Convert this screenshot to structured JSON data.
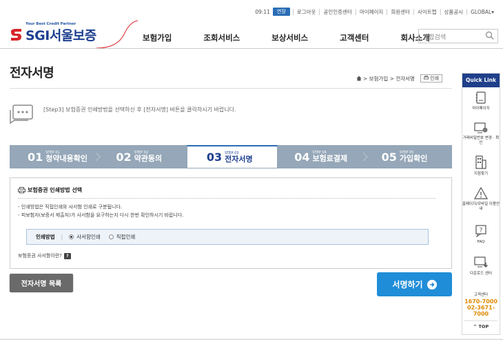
{
  "util": {
    "time": "09:11",
    "extend": "연장",
    "links": [
      "로그아웃",
      "공인인증센터",
      "마이페이지",
      "회원센터",
      "사이트맵",
      "상품공시",
      "GLOBAL▾"
    ]
  },
  "logo": {
    "tagline": "Your Best Credit Partner",
    "name_sgi": "SGI",
    "name_kr": "서울보증"
  },
  "gnb": [
    "보험가입",
    "조회서비스",
    "보상서비스",
    "고객센터",
    "회사소개"
  ],
  "search": {
    "placeholder": "통합검색"
  },
  "page": {
    "title": "전자서명",
    "breadcrumb": "> 보험가입 > 전자서명",
    "print": "인쇄"
  },
  "notice": "[Step3] 보험증권 인쇄방법을 선택하신 후 [전자서명] 버튼을 클릭하시기 바랍니다.",
  "steps": [
    {
      "num": "01",
      "step": "STEP 01",
      "name": "청약내용확인"
    },
    {
      "num": "02",
      "step": "STEP 02",
      "name": "약관동의"
    },
    {
      "num": "03",
      "step": "STEP 03",
      "name": "전자서명"
    },
    {
      "num": "04",
      "step": "STEP 04",
      "name": "보험료결제"
    },
    {
      "num": "05",
      "step": "STEP 05",
      "name": "가입확인"
    }
  ],
  "box": {
    "title": "보험증권 인쇄방법 선택",
    "bullets": [
      "- 인쇄방법은 직접인쇄와 사서함 인쇄로 구분됩니다.",
      "- 피보험자(보증서 제출처)가 사서함을 요구하는지 다시 한번 확인하시기 바랍니다."
    ],
    "method_label": "인쇄방법",
    "option_1": "사서함인쇄",
    "option_2": "직접인쇄",
    "selected": "사서함인쇄",
    "qa": "보험증권 사서함이란?",
    "qa_badge": "?"
  },
  "buttons": {
    "list": "전자서명 목록",
    "sign": "서명하기"
  },
  "quick": {
    "title": "Quick Link",
    "items": [
      "마이페이지",
      "거래비밀번호 변경 · 확인",
      "지점찾기",
      "홈페이지/모바일 이용안내",
      "FAQ",
      "다운로드 센터"
    ],
    "tel_label": "고객센터",
    "tel_1": "1670-7000",
    "tel_2": "02-3671-7000",
    "top": "^ TOP"
  }
}
